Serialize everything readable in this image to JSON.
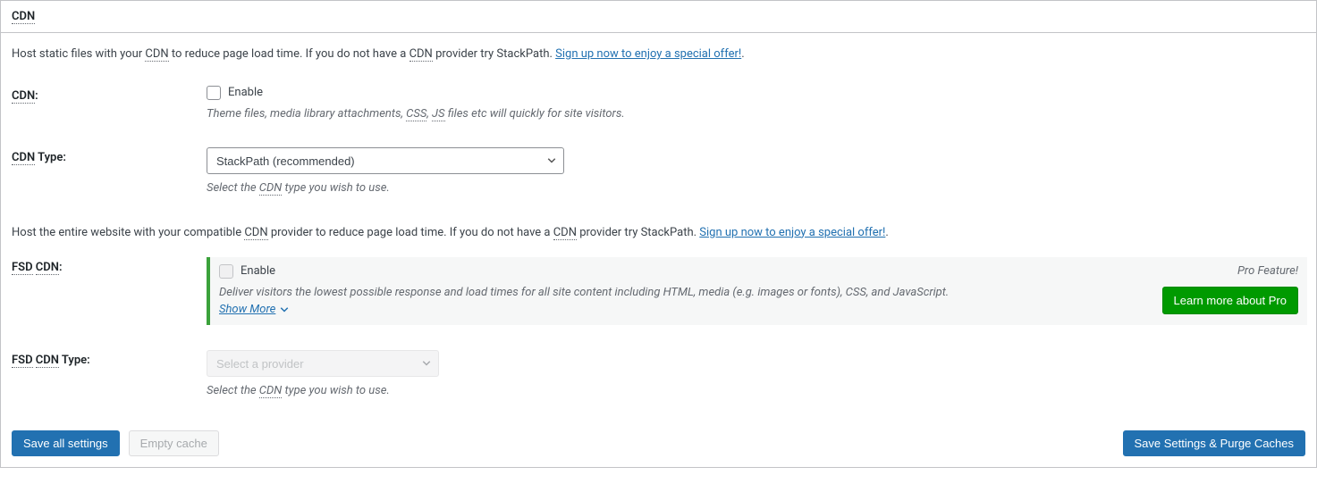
{
  "panel": {
    "title": "CDN"
  },
  "intro1": {
    "prefix": "Host static files with your ",
    "abbr1": "CDN",
    "mid1": " to reduce page load time. If you do not have a ",
    "abbr2": "CDN",
    "mid2": " provider try StackPath. ",
    "link": "Sign up now to enjoy a special offer!",
    "suffix": "."
  },
  "cdn": {
    "label_prefix_abbr": "CDN",
    "label_suffix": ":",
    "checkbox_label": "Enable",
    "help_prefix": "Theme files, media library attachments, ",
    "help_abbr1": "CSS",
    "help_comma": ", ",
    "help_abbr2": "JS",
    "help_suffix": " files etc will quickly for site visitors."
  },
  "cdn_type": {
    "label_prefix_abbr": "CDN",
    "label_suffix": " Type:",
    "selected": "StackPath (recommended)",
    "help_prefix": "Select the ",
    "help_abbr": "CDN",
    "help_suffix": " type you wish to use."
  },
  "intro2": {
    "prefix": "Host the entire website with your compatible ",
    "abbr1": "CDN",
    "mid1": " provider to reduce page load time. If you do not have a ",
    "abbr2": "CDN",
    "mid2": " provider try StackPath. ",
    "link": "Sign up now to enjoy a special offer!",
    "suffix": "."
  },
  "fsd": {
    "label_abbr1": "FSD",
    "label_space": " ",
    "label_abbr2": "CDN",
    "label_suffix": ":",
    "checkbox_label": "Enable",
    "help": "Deliver visitors the lowest possible response and load times for all site content including HTML, media (e.g. images or fonts), CSS, and JavaScript.",
    "show_more": "Show More",
    "pro_feature": "Pro Feature!",
    "learn_more": "Learn more about Pro"
  },
  "fsd_type": {
    "label_abbr1": "FSD",
    "label_space": " ",
    "label_abbr2": "CDN",
    "label_suffix": " Type:",
    "placeholder": "Select a provider",
    "help_prefix": "Select the ",
    "help_abbr": "CDN",
    "help_suffix": " type you wish to use."
  },
  "footer": {
    "save_all": "Save all settings",
    "empty_cache": "Empty cache",
    "save_purge": "Save Settings & Purge Caches"
  }
}
